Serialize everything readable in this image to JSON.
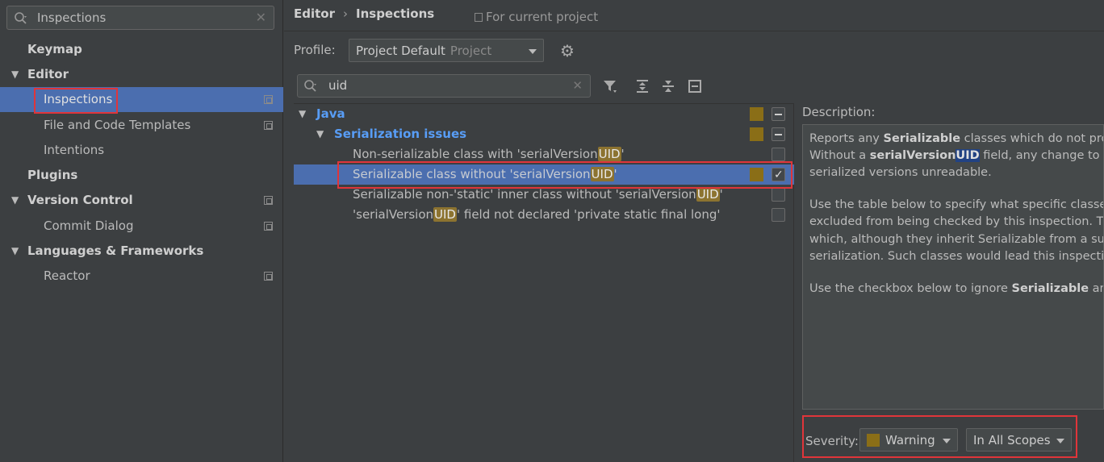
{
  "sidebar": {
    "search_value": "Inspections",
    "items": [
      {
        "label": "Keymap"
      },
      {
        "label": "Editor"
      },
      {
        "label": "Inspections"
      },
      {
        "label": "File and Code Templates"
      },
      {
        "label": "Intentions"
      },
      {
        "label": "Plugins"
      },
      {
        "label": "Version Control"
      },
      {
        "label": "Commit Dialog"
      },
      {
        "label": "Languages & Frameworks"
      },
      {
        "label": "Reactor"
      }
    ]
  },
  "header": {
    "crumb1": "Editor",
    "crumb_sep": "›",
    "crumb2": "Inspections",
    "scope_note": "For current project"
  },
  "profile": {
    "label": "Profile:",
    "value": "Project Default",
    "sub": "Project"
  },
  "filter": {
    "value": "uid"
  },
  "tree": {
    "java": "Java",
    "serialization": "Serialization issues",
    "items": [
      {
        "pre": "Non-serializable class with 'serialVersion",
        "hl": "UID",
        "post": "'"
      },
      {
        "pre": "Serializable class without 'serialVersion",
        "hl": "UID",
        "post": "'"
      },
      {
        "pre": "Serializable non-'static' inner class without 'serialVersion",
        "hl": "UID",
        "post": "'"
      },
      {
        "pre": "'serialVersion",
        "hl": "UID",
        "post": "' field not declared 'private static final long'"
      }
    ]
  },
  "description": {
    "label": "Description:",
    "line1_a": "Reports any ",
    "line1_b": "Serializable",
    "line1_c": " classes which do not prov",
    "line2_a": "Without a ",
    "line2_b": "serialVersion",
    "line2_c": "UID",
    "line2_d": " field, any change to a c",
    "line3": "serialized versions unreadable.",
    "line4": "Use the table below to specify what specific classe",
    "line5": "excluded from being checked by this inspection. T",
    "line6": "which, although they inherit Serializable from a sup",
    "line7": "serialization. Such classes would lead this inspectio",
    "line8_a": "Use the checkbox below to ignore ",
    "line8_b": "Serializable",
    "line8_c": " and"
  },
  "severity": {
    "label": "Severity:",
    "value": "Warning",
    "scope": "In All Scopes"
  },
  "colors": {
    "selection": "#4b6eaf",
    "warning": "#8a6e17",
    "highlight_box": "#e0353a"
  }
}
